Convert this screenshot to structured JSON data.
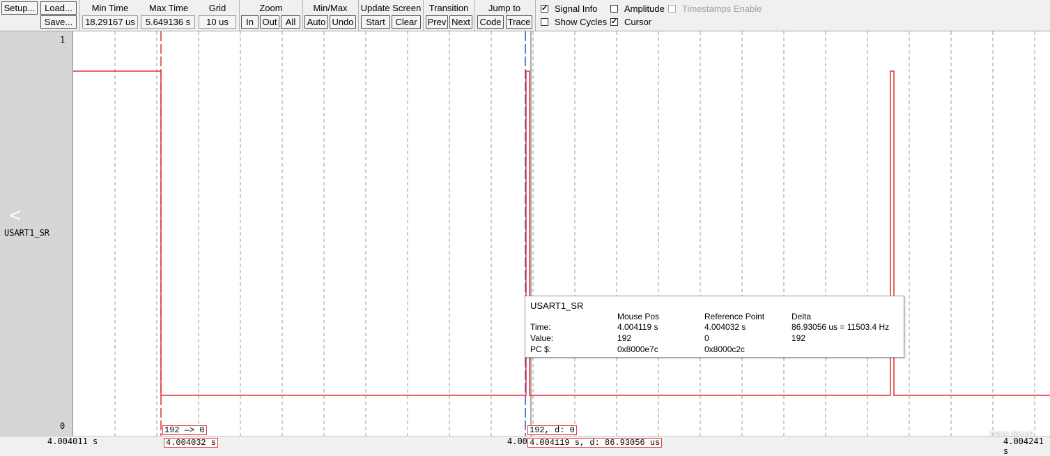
{
  "toolbar": {
    "setup": "Setup...",
    "load": "Load...",
    "save": "Save...",
    "min_time": {
      "label": "Min Time",
      "value": "18.29167 us"
    },
    "max_time": {
      "label": "Max Time",
      "value": "5.649136 s"
    },
    "grid": {
      "label": "Grid",
      "value": "10 us"
    },
    "zoom": {
      "label": "Zoom",
      "in": "In",
      "out": "Out",
      "all": "All"
    },
    "minmax": {
      "label": "Min/Max",
      "auto": "Auto",
      "undo": "Undo"
    },
    "update_screen": {
      "label": "Update Screen",
      "start": "Start",
      "clear": "Clear"
    },
    "transition": {
      "label": "Transition",
      "prev": "Prev",
      "next": "Next"
    },
    "jump_to": {
      "label": "Jump to",
      "code": "Code",
      "trace": "Trace"
    },
    "checkboxes": {
      "signal_info": {
        "label": "Signal Info",
        "checked": true
      },
      "show_cycles": {
        "label": "Show Cycles",
        "checked": false
      },
      "amplitude": {
        "label": "Amplitude",
        "checked": false
      },
      "cursor": {
        "label": "Cursor",
        "checked": true
      },
      "timestamps": {
        "label": "Timestamps Enable",
        "checked": false,
        "disabled": true
      }
    }
  },
  "signal": {
    "name": "USART1_SR",
    "y_max": "1",
    "y_min": "0",
    "color": "#e03030",
    "cursor_color": "#e03030",
    "mouse_line_color": "#3050d0"
  },
  "markers": {
    "cursor_value": "192 —> 0",
    "cursor_time": "4.004032 s",
    "mouse_value": "192,   d: 0",
    "mouse_time": "4.004119 s,   d: 86.93056 us"
  },
  "time_axis": {
    "left": "4.004011 s",
    "mid_partial": "4.00",
    "right": "4.004241 s"
  },
  "info_box": {
    "title": "USART1_SR",
    "headers": {
      "mouse_pos": "Mouse Pos",
      "reference_point": "Reference Point",
      "delta": "Delta"
    },
    "rows": [
      {
        "label": "Time:",
        "mouse": "4.004119 s",
        "ref": "4.004032 s",
        "delta": "86.93056 us = 11503.4 Hz"
      },
      {
        "label": "Value:",
        "mouse": "192",
        "ref": "0",
        "delta": "192"
      },
      {
        "label": "PC $:",
        "mouse": "0x8000e7c",
        "ref": "0x8000c2c",
        "delta": ""
      }
    ]
  },
  "nav": {
    "back_glyph": "<"
  },
  "watermark": "CSDN @GHP"
}
